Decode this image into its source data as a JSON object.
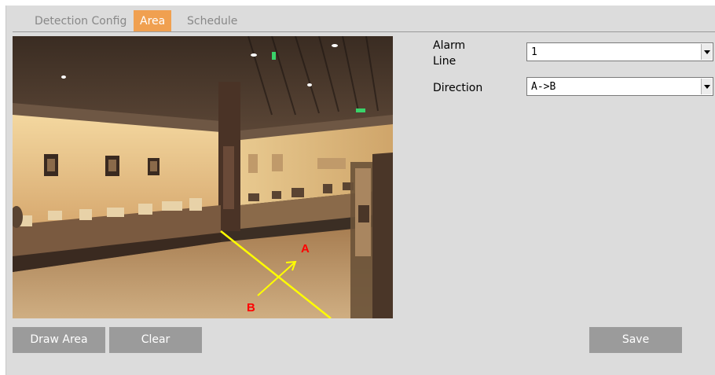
{
  "tabs": [
    {
      "label": "Detection Config",
      "active": false
    },
    {
      "label": "Area",
      "active": true
    },
    {
      "label": "Schedule",
      "active": false
    }
  ],
  "colors": {
    "panel_bg": "#dcdcdc",
    "tab_active_bg": "#f0a050",
    "tab_text": "#888888",
    "button_bg": "#9b9b9b",
    "alarm_line": "#ffff00",
    "direction_label": "#ff0000"
  },
  "video": {
    "label_a": "A",
    "label_b": "B"
  },
  "form": {
    "alarm_line_label": "Alarm\nLine",
    "alarm_line_value": "1",
    "direction_label": "Direction",
    "direction_value": "A->B"
  },
  "buttons": {
    "draw_area": "Draw Area",
    "clear": "Clear",
    "save": "Save"
  }
}
